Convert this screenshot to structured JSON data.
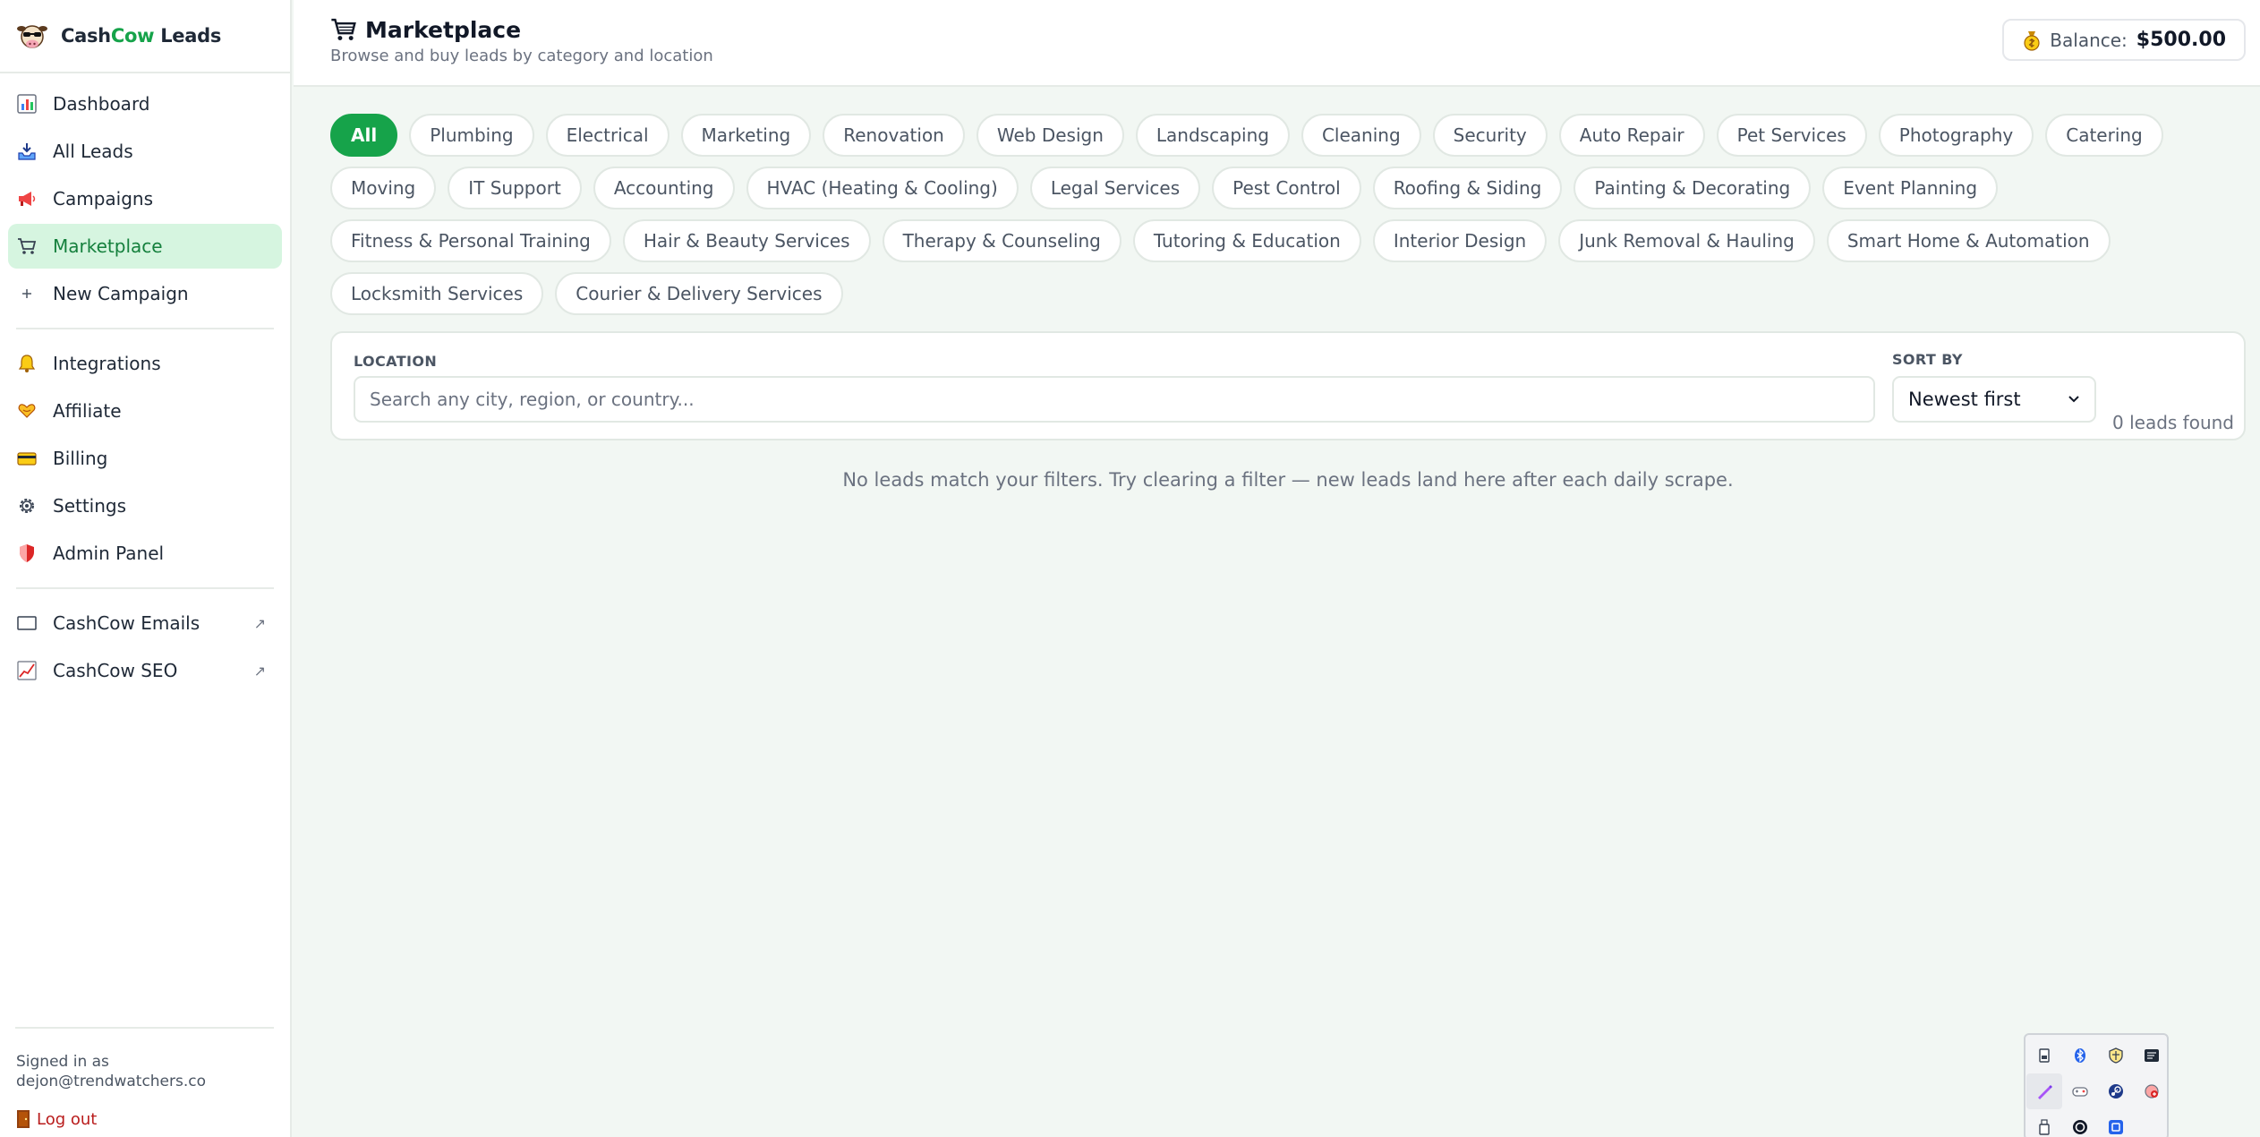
{
  "sidebar": {
    "brand": {
      "part1": "Cash",
      "part2": "Cow",
      "part3": " Leads"
    },
    "primary_items": [
      {
        "label": "Dashboard",
        "icon": "bar-chart-icon",
        "active": false
      },
      {
        "label": "All Leads",
        "icon": "inbox-tray-icon",
        "active": false
      },
      {
        "label": "Campaigns",
        "icon": "megaphone-icon",
        "active": false
      },
      {
        "label": "Marketplace",
        "icon": "shopping-cart-icon",
        "active": true
      },
      {
        "label": "New Campaign",
        "icon": "plus-icon",
        "active": false
      }
    ],
    "secondary_items": [
      {
        "label": "Integrations",
        "icon": "bell-icon"
      },
      {
        "label": "Affiliate",
        "icon": "heart-hands-icon"
      },
      {
        "label": "Billing",
        "icon": "credit-card-icon"
      },
      {
        "label": "Settings",
        "icon": "gear-icon"
      },
      {
        "label": "Admin Panel",
        "icon": "shield-icon"
      }
    ],
    "external_items": [
      {
        "label": "CashCow Emails",
        "icon": "email-icon",
        "ext": "↗"
      },
      {
        "label": "CashCow SEO",
        "icon": "trend-chart-icon",
        "ext": "↗"
      }
    ],
    "footer": {
      "signed_in_label": "Signed in as",
      "email": "dejon@trendwatchers.co",
      "logout_label": "Log out"
    }
  },
  "header": {
    "title": "Marketplace",
    "subtitle": "Browse and buy leads by category and location",
    "balance_label": "Balance:",
    "balance_value": "$500.00"
  },
  "categories": [
    {
      "label": "All",
      "active": true
    },
    {
      "label": "Plumbing"
    },
    {
      "label": "Electrical"
    },
    {
      "label": "Marketing"
    },
    {
      "label": "Renovation"
    },
    {
      "label": "Web Design"
    },
    {
      "label": "Landscaping"
    },
    {
      "label": "Cleaning"
    },
    {
      "label": "Security"
    },
    {
      "label": "Auto Repair"
    },
    {
      "label": "Pet Services"
    },
    {
      "label": "Photography"
    },
    {
      "label": "Catering"
    },
    {
      "label": "Moving"
    },
    {
      "label": "IT Support"
    },
    {
      "label": "Accounting"
    },
    {
      "label": "HVAC (Heating & Cooling)"
    },
    {
      "label": "Legal Services"
    },
    {
      "label": "Pest Control"
    },
    {
      "label": "Roofing & Siding"
    },
    {
      "label": "Painting & Decorating"
    },
    {
      "label": "Event Planning"
    },
    {
      "label": "Fitness & Personal Training"
    },
    {
      "label": "Hair & Beauty Services"
    },
    {
      "label": "Therapy & Counseling"
    },
    {
      "label": "Tutoring & Education"
    },
    {
      "label": "Interior Design"
    },
    {
      "label": "Junk Removal & Hauling"
    },
    {
      "label": "Smart Home & Automation"
    },
    {
      "label": "Locksmith Services"
    },
    {
      "label": "Courier & Delivery Services"
    }
  ],
  "filters": {
    "location_label": "LOCATION",
    "location_value": "",
    "location_placeholder": "Search any city, region, or country...",
    "sort_label": "SORT BY",
    "sort_value": "Newest first",
    "leads_found": "0 leads found"
  },
  "empty_message": "No leads match your filters. Try clearing a filter — new leads land here after each daily scrape.",
  "tray": {
    "icons": [
      "usb-drive-icon",
      "bluetooth-icon",
      "shield-app-icon",
      "terminal-icon",
      "pen-icon",
      "game-controller-icon",
      "steam-icon",
      "antivirus-icon",
      "usb-stick-icon",
      "chatgpt-icon",
      "screenshot-app-icon"
    ]
  },
  "colors": {
    "accent": "#16a34a",
    "accent_light": "#d6f5e0",
    "logout": "#b91c1c"
  }
}
